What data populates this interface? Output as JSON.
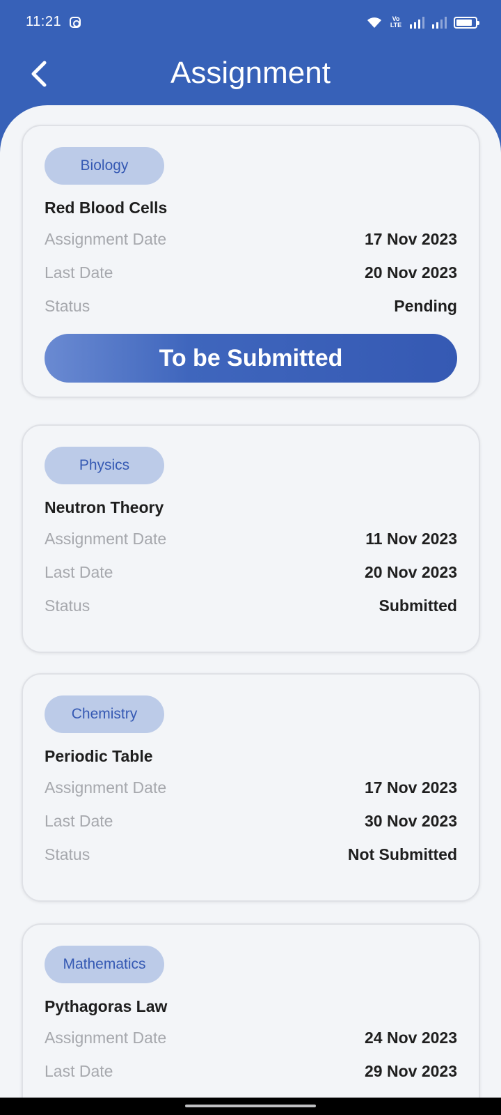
{
  "status_bar": {
    "time": "11:21",
    "volte": "Vo LTE"
  },
  "header": {
    "title": "Assignment"
  },
  "labels": {
    "assignment_date": "Assignment Date",
    "last_date": "Last Date",
    "status": "Status"
  },
  "cards": [
    {
      "subject": "Biology",
      "title": "Red Blood Cells",
      "assignment_date": "17 Nov 2023",
      "last_date": "20 Nov 2023",
      "status": "Pending",
      "button_label": "To be Submitted"
    },
    {
      "subject": "Physics",
      "title": "Neutron Theory",
      "assignment_date": "11 Nov 2023",
      "last_date": "20 Nov 2023",
      "status": "Submitted"
    },
    {
      "subject": "Chemistry",
      "title": "Periodic Table",
      "assignment_date": "17 Nov 2023",
      "last_date": "30 Nov 2023",
      "status": "Not Submitted"
    },
    {
      "subject": "Mathematics",
      "title": "Pythagoras Law",
      "assignment_date": "24 Nov 2023",
      "last_date": "29 Nov 2023"
    }
  ],
  "colors": {
    "primary": "#3761b8",
    "chip_bg": "#bccbe8",
    "background": "#f3f5f8"
  },
  "icons": [
    "back-arrow-icon",
    "instagram-icon",
    "wifi-icon",
    "signal-icon",
    "battery-icon"
  ]
}
